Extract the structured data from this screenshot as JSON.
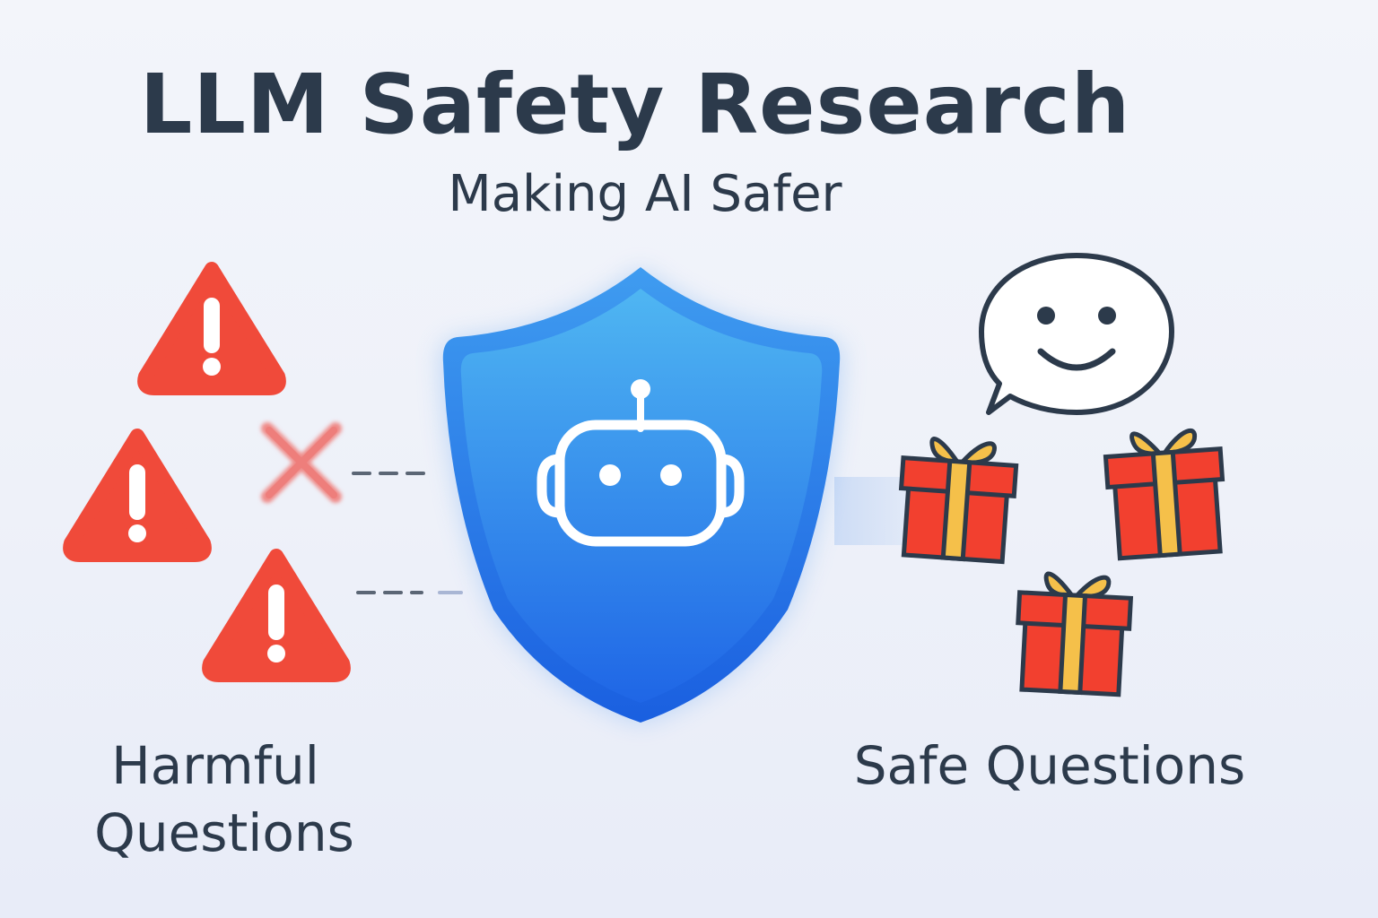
{
  "header": {
    "title": "LLM Safety Research",
    "subtitle": "Making AI Safer"
  },
  "labels": {
    "harmful_line1": "Harmful",
    "harmful_line2": "Questions",
    "safe": "Safe Questions"
  },
  "icons": {
    "warnings": [
      "warning-icon",
      "warning-icon",
      "warning-icon"
    ],
    "blocked": "x-mark-icon",
    "guard": "shield-icon",
    "model": "robot-icon",
    "response": "smiley-speech-bubble-icon",
    "gifts": [
      "gift-icon",
      "gift-icon",
      "gift-icon"
    ]
  },
  "colors": {
    "text": "#2c3a4b",
    "warning_red": "#f04a3a",
    "cross_red": "#ef8a87",
    "shield_blue_top": "#4cb4f1",
    "shield_blue_bottom": "#1d62e3",
    "gift_red": "#f2402f",
    "gift_ribbon": "#f5c04a"
  }
}
